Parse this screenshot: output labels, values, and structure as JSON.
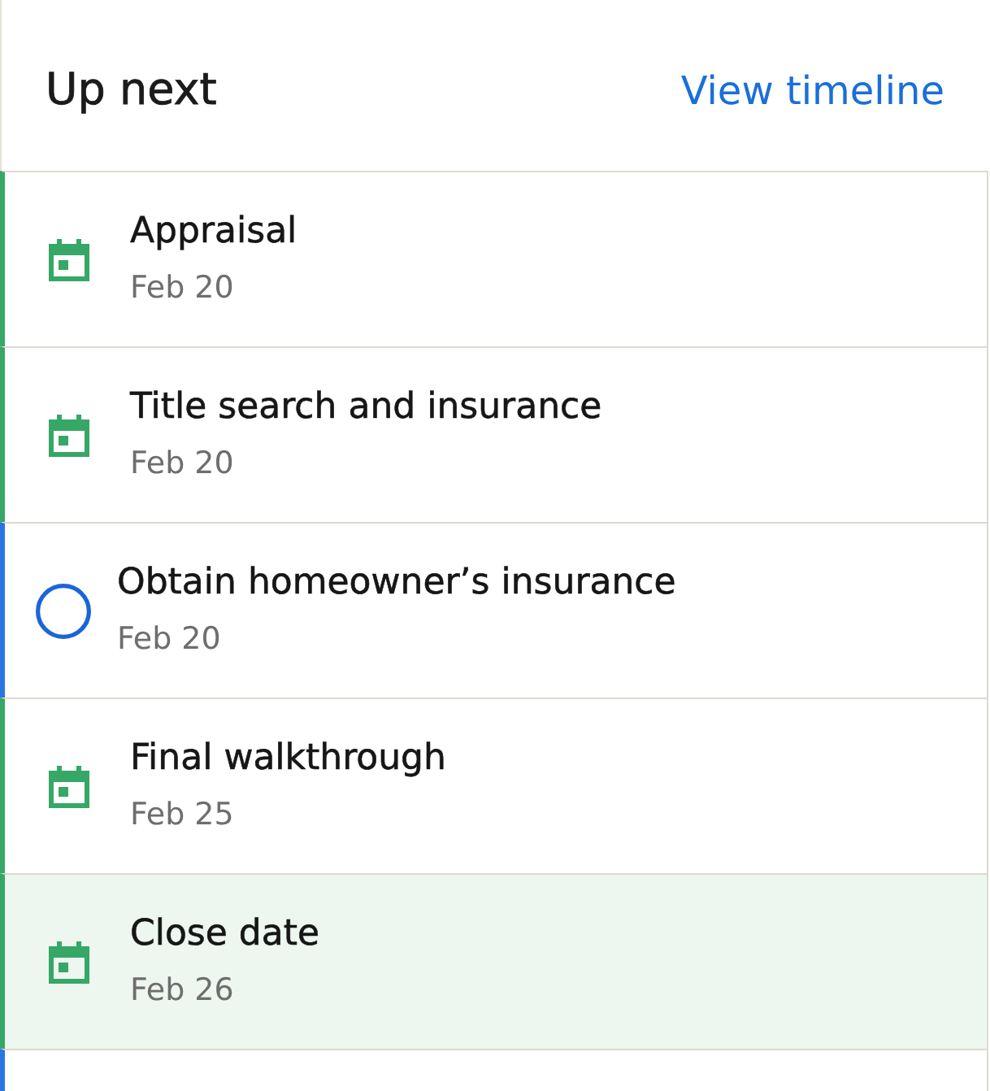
{
  "header": {
    "title": "Up next",
    "link": "View timeline"
  },
  "items": [
    {
      "kind": "event",
      "title": "Appraisal",
      "date": "Feb 20",
      "selected": false
    },
    {
      "kind": "event",
      "title": "Title search and insurance",
      "date": "Feb 20",
      "selected": false
    },
    {
      "kind": "task",
      "title": "Obtain homeowner’s insurance",
      "date": "Feb 20",
      "selected": false
    },
    {
      "kind": "event",
      "title": "Final walkthrough",
      "date": "Feb 25",
      "selected": false
    },
    {
      "kind": "event",
      "title": "Close date",
      "date": "Feb 26",
      "selected": true
    },
    {
      "kind": "task",
      "selected": false
    }
  ]
}
